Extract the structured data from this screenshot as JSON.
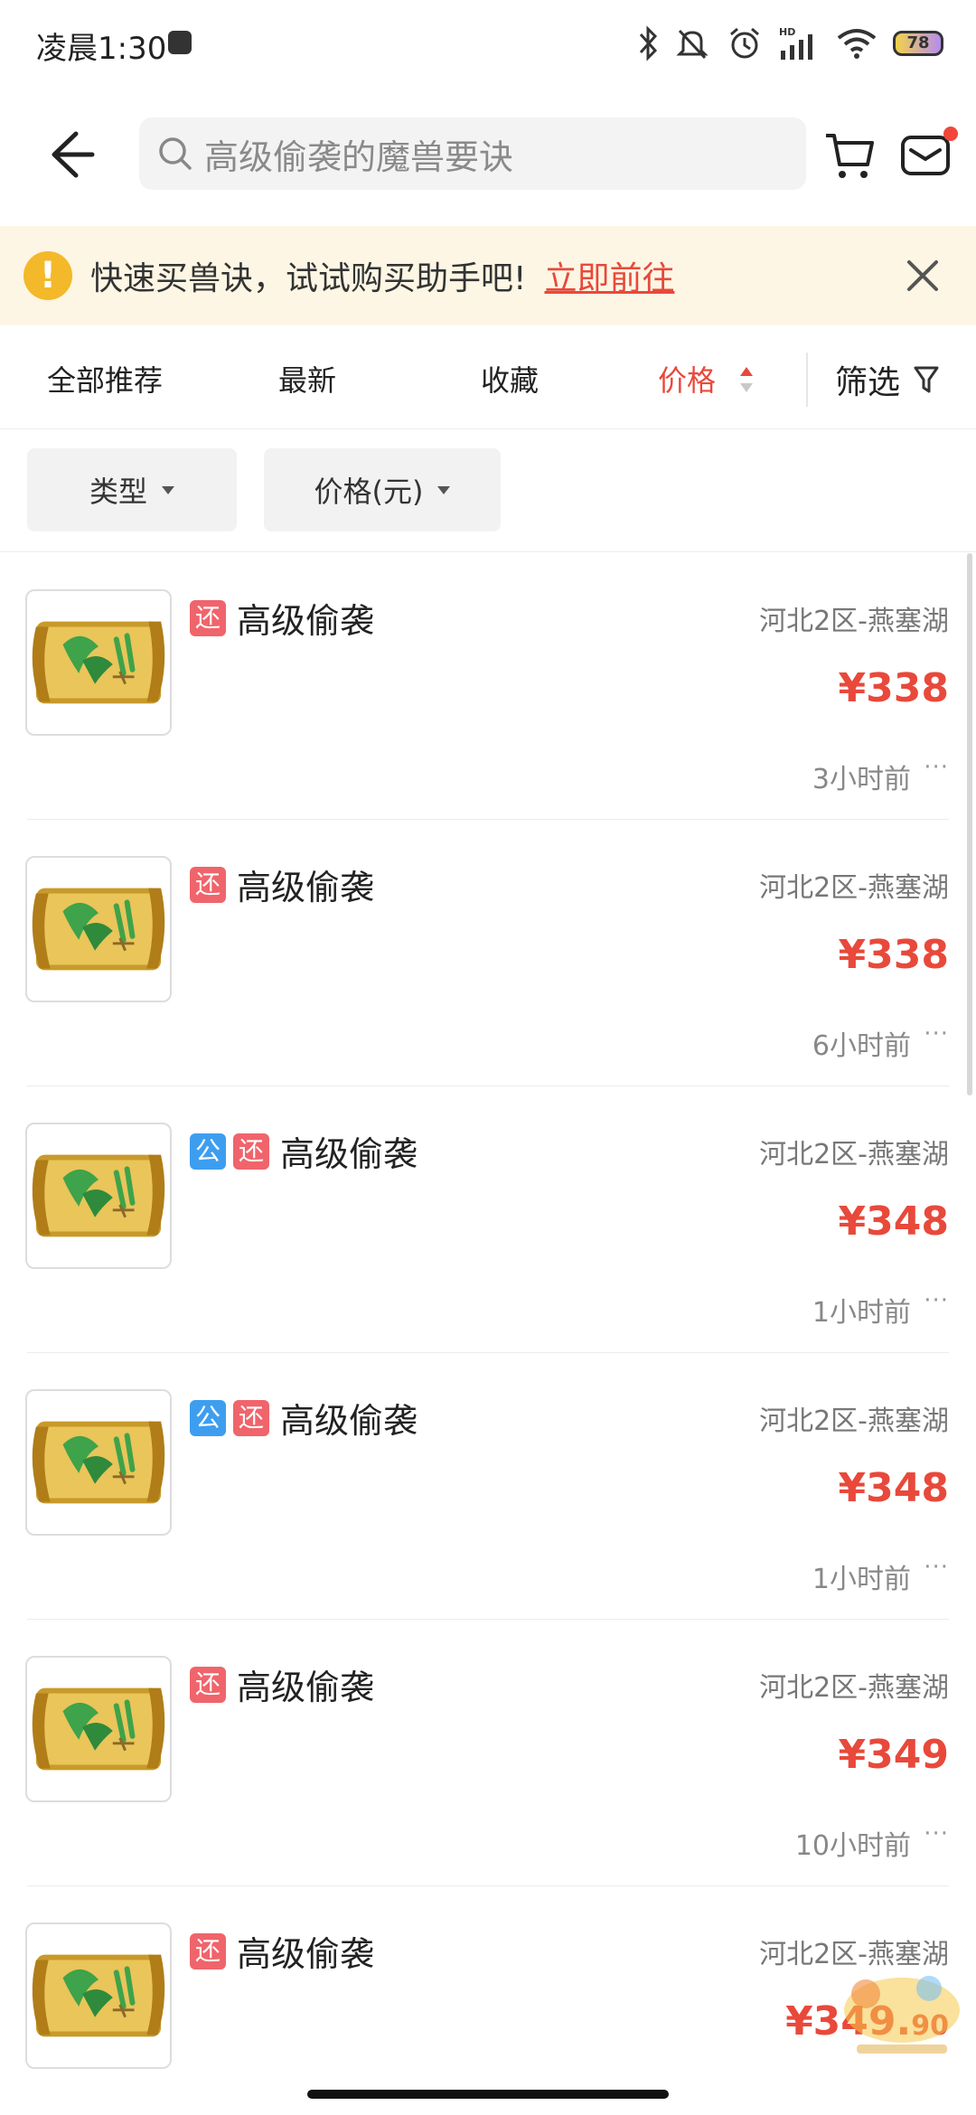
{
  "status_bar": {
    "time": "凌晨1:30",
    "battery": "78"
  },
  "top_bar": {
    "search_placeholder": "高级偷袭的魔兽要诀"
  },
  "banner": {
    "text": "快速买兽诀，试试购买助手吧!",
    "link": "立即前往"
  },
  "sort_tabs": [
    {
      "label": "全部推荐"
    },
    {
      "label": "最新"
    },
    {
      "label": "收藏"
    },
    {
      "label": "价格"
    }
  ],
  "filter_label": "筛选",
  "chips": [
    {
      "label": "类型"
    },
    {
      "label": "价格(元)"
    }
  ],
  "listings": [
    {
      "tags": [
        "还"
      ],
      "title": "高级偷袭",
      "server": "河北2区-燕塞湖",
      "price": "¥338",
      "cents": "",
      "time": "3小时前"
    },
    {
      "tags": [
        "还"
      ],
      "title": "高级偷袭",
      "server": "河北2区-燕塞湖",
      "price": "¥338",
      "cents": "",
      "time": "6小时前"
    },
    {
      "tags": [
        "公",
        "还"
      ],
      "title": "高级偷袭",
      "server": "河北2区-燕塞湖",
      "price": "¥348",
      "cents": "",
      "time": "1小时前"
    },
    {
      "tags": [
        "公",
        "还"
      ],
      "title": "高级偷袭",
      "server": "河北2区-燕塞湖",
      "price": "¥348",
      "cents": "",
      "time": "1小时前"
    },
    {
      "tags": [
        "还"
      ],
      "title": "高级偷袭",
      "server": "河北2区-燕塞湖",
      "price": "¥349",
      "cents": "",
      "time": "10小时前"
    },
    {
      "tags": [
        "还"
      ],
      "title": "高级偷袭",
      "server": "河北2区-燕塞湖",
      "price": "¥349.",
      "cents": "90",
      "time": ""
    }
  ],
  "more_label": "···",
  "colors": {
    "accent": "#e8493b",
    "tag_huan": "#f0646b",
    "tag_gong": "#3d9ef0",
    "banner_bg": "#fdf6e4"
  }
}
